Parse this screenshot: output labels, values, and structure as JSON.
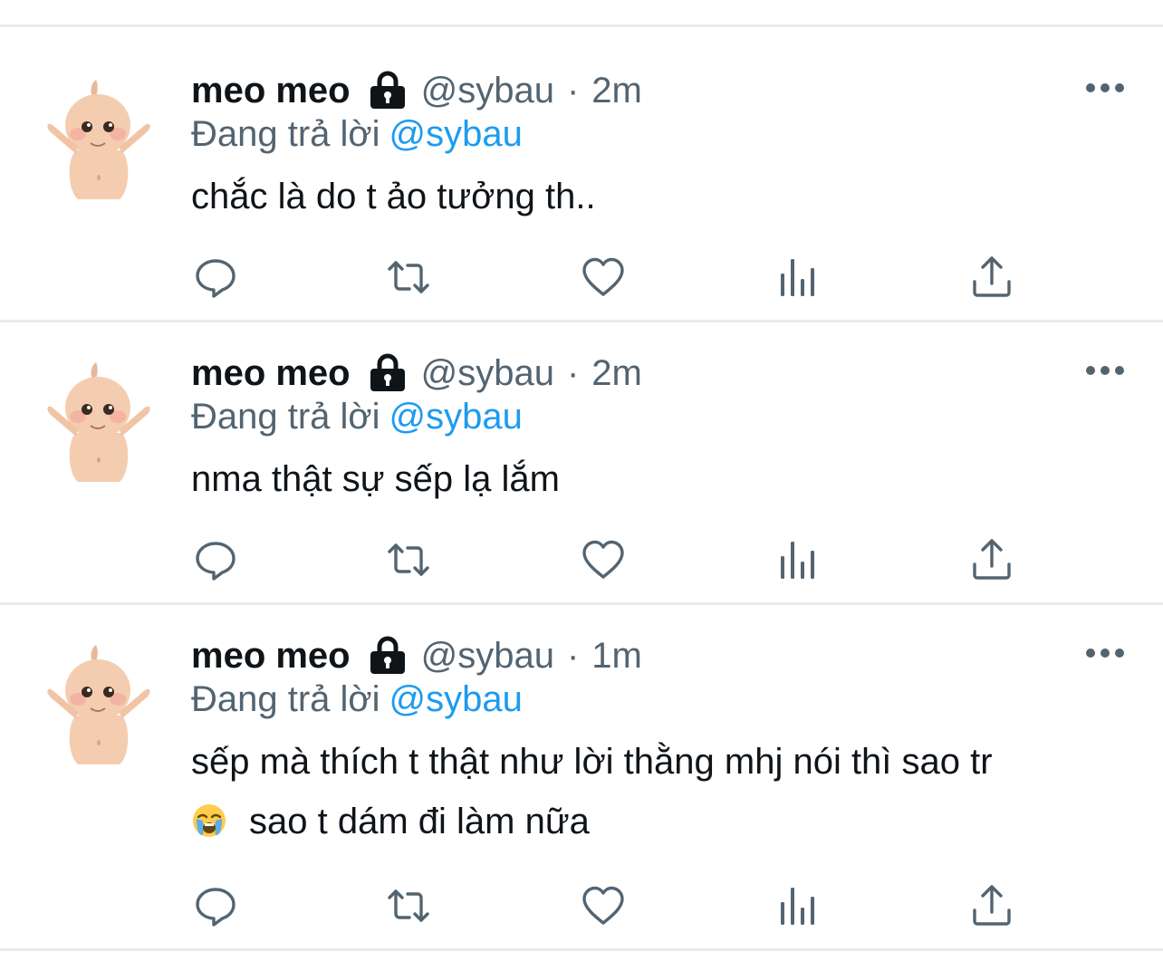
{
  "tweets": [
    {
      "name": "meo meo",
      "handle": "@sybau",
      "separator": "·",
      "time": "2m",
      "reply_prefix": "Đang trả lời",
      "reply_to": "@sybau",
      "text_line1": "chắc là do t ảo tưởng th..",
      "text_line2": ""
    },
    {
      "name": "meo meo",
      "handle": "@sybau",
      "separator": "·",
      "time": "2m",
      "reply_prefix": "Đang trả lời",
      "reply_to": "@sybau",
      "text_line1": "nma thật sự sếp lạ lắm",
      "text_line2": ""
    },
    {
      "name": "meo meo",
      "handle": "@sybau",
      "separator": "·",
      "time": "1m",
      "reply_prefix": "Đang trả lời",
      "reply_to": "@sybau",
      "text_line1": "sếp mà thích t thật như lời thằng mhj nói thì sao tr",
      "text_line2": "sao t dám đi làm nữa",
      "emoji": "loudly-crying-face"
    }
  ],
  "icons": {
    "account": "lock-icon",
    "more": "more-icon",
    "reply": "reply-icon",
    "retweet": "retweet-icon",
    "like": "like-icon",
    "views": "views-icon",
    "share": "share-icon"
  },
  "colors": {
    "text": "#0f1419",
    "secondary": "#536471",
    "link": "#1d9bf0",
    "divider": "#e9ebee"
  }
}
